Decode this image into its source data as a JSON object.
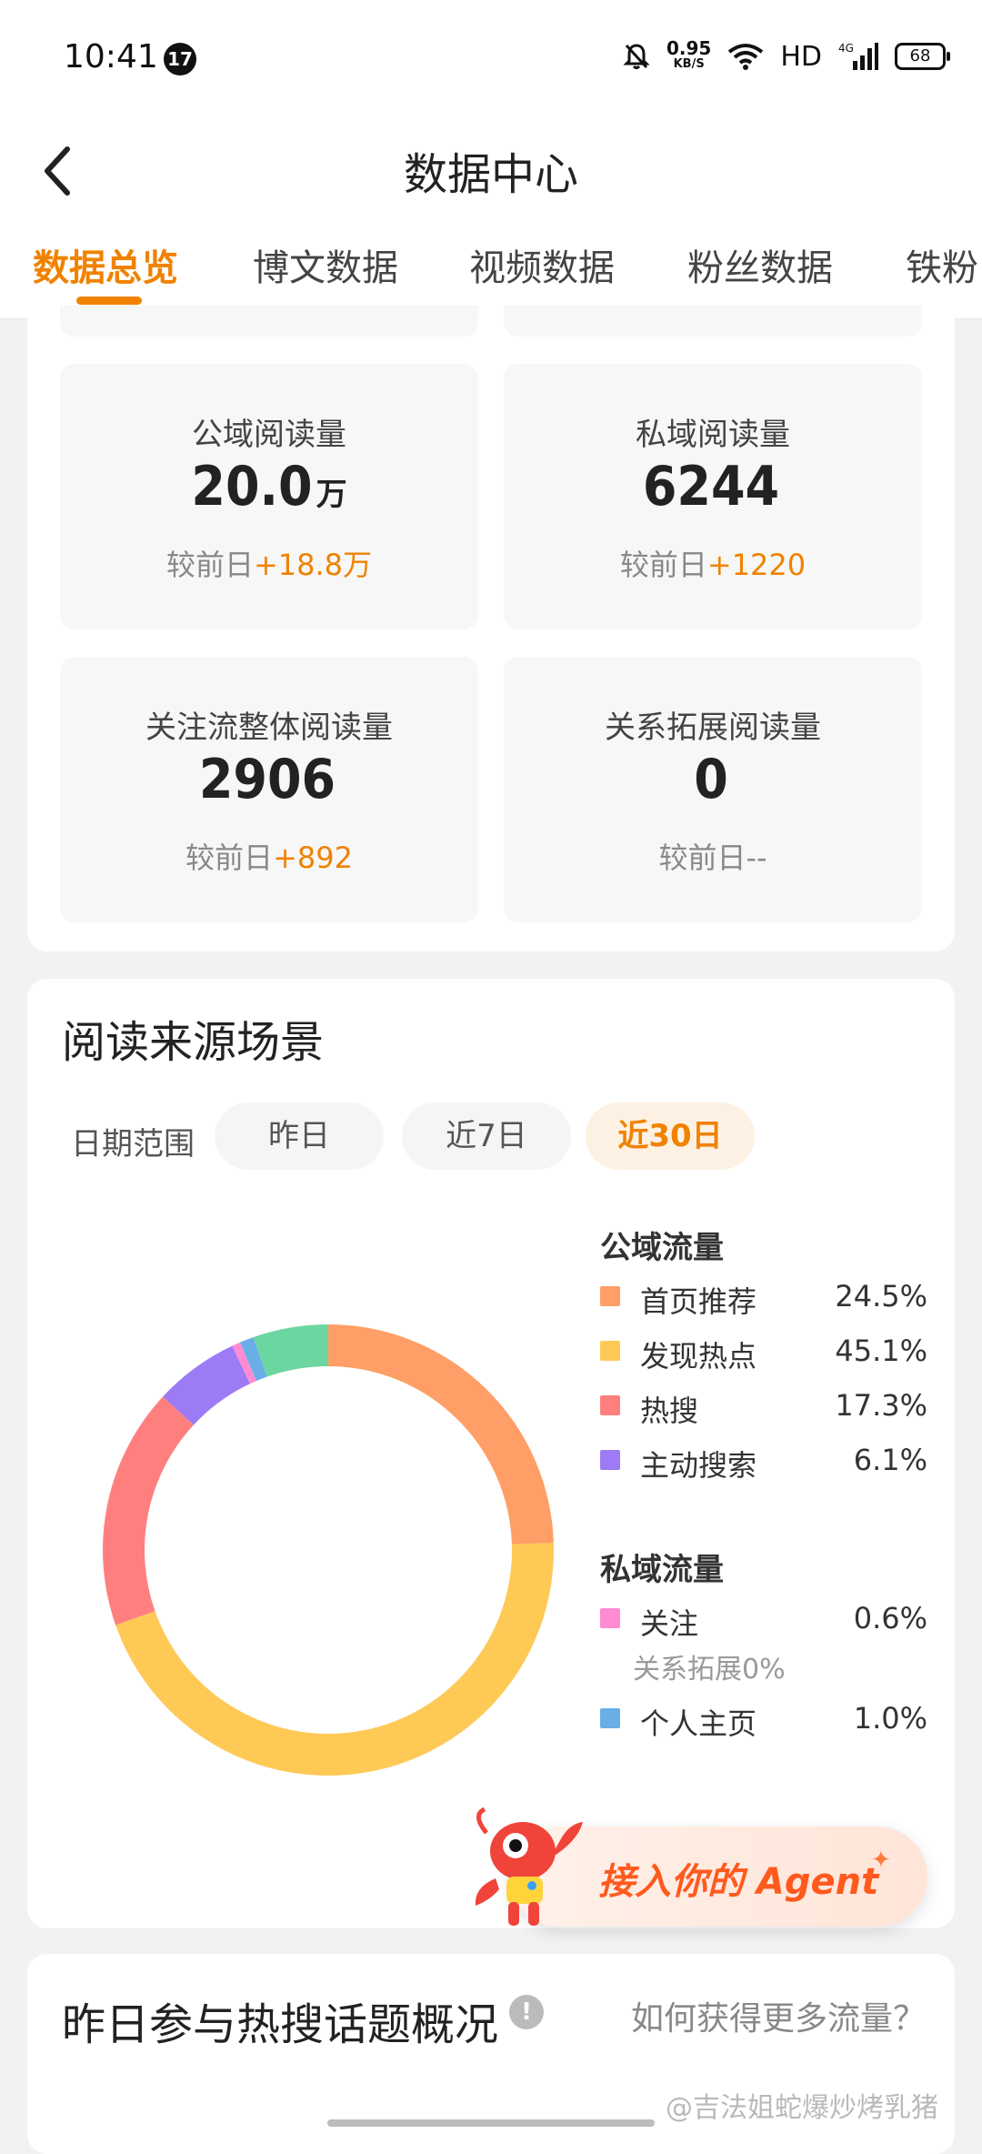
{
  "status_bar": {
    "time": "10:41",
    "notification_count": "17",
    "net_speed": "0.95",
    "net_speed_unit": "KB/S",
    "hd_label": "HD",
    "signal_label": "4G",
    "battery": "68"
  },
  "header": {
    "title": "数据中心",
    "back_icon": "chevron-left-icon"
  },
  "tabs": [
    {
      "label": "数据总览",
      "active": true
    },
    {
      "label": "博文数据",
      "active": false
    },
    {
      "label": "视频数据",
      "active": false
    },
    {
      "label": "粉丝数据",
      "active": false
    },
    {
      "label": "铁粉",
      "active": false
    }
  ],
  "stats": [
    {
      "label": "公域阅读量",
      "value": "20.0",
      "unit": "万",
      "compare_prefix": "较前日",
      "delta": "+18.8万"
    },
    {
      "label": "私域阅读量",
      "value": "6244",
      "unit": "",
      "compare_prefix": "较前日",
      "delta": "+1220"
    },
    {
      "label": "关注流整体阅读量",
      "value": "2906",
      "unit": "",
      "compare_prefix": "较前日",
      "delta": "+892"
    },
    {
      "label": "关系拓展阅读量",
      "value": "0",
      "unit": "",
      "compare_prefix": "较前日",
      "delta": "--"
    }
  ],
  "source_section": {
    "title": "阅读来源场景",
    "date_range_label": "日期范围",
    "date_options": [
      "昨日",
      "近7日",
      "近30日"
    ],
    "selected_date_option": "近30日"
  },
  "chart_data": {
    "type": "pie",
    "title": "",
    "groups": [
      {
        "name": "公域流量",
        "items": [
          {
            "name": "首页推荐",
            "value": 24.5,
            "label": "24.5%",
            "color": "#ff9e66"
          },
          {
            "name": "发现热点",
            "value": 45.1,
            "label": "45.1%",
            "color": "#ffc956"
          },
          {
            "name": "热搜",
            "value": 17.3,
            "label": "17.3%",
            "color": "#ff7f7f"
          },
          {
            "name": "主动搜索",
            "value": 6.1,
            "label": "6.1%",
            "color": "#9d7bf5"
          }
        ]
      },
      {
        "name": "私域流量",
        "items": [
          {
            "name": "关注",
            "value": 0.6,
            "label": "0.6%",
            "color": "#ff8bd3"
          },
          {
            "name": "个人主页",
            "value": 1.0,
            "label": "1.0%",
            "color": "#6aaee8"
          }
        ],
        "note": "关系拓展0%"
      }
    ],
    "unlabeled_slice": {
      "value": 5.4,
      "color": "#6cd6a0"
    }
  },
  "agent_banner": {
    "text": "接入你的 Agent",
    "spark_icon": "sparkle-icon",
    "mascot_icon": "lobster-mascot-icon"
  },
  "hot_section": {
    "title": "昨日参与热搜话题概况",
    "help_icon": "info-icon",
    "help_icon_text": "!",
    "more_link": "如何获得更多流量？"
  },
  "watermark": "@吉法姐蛇爆炒烤乳猪"
}
